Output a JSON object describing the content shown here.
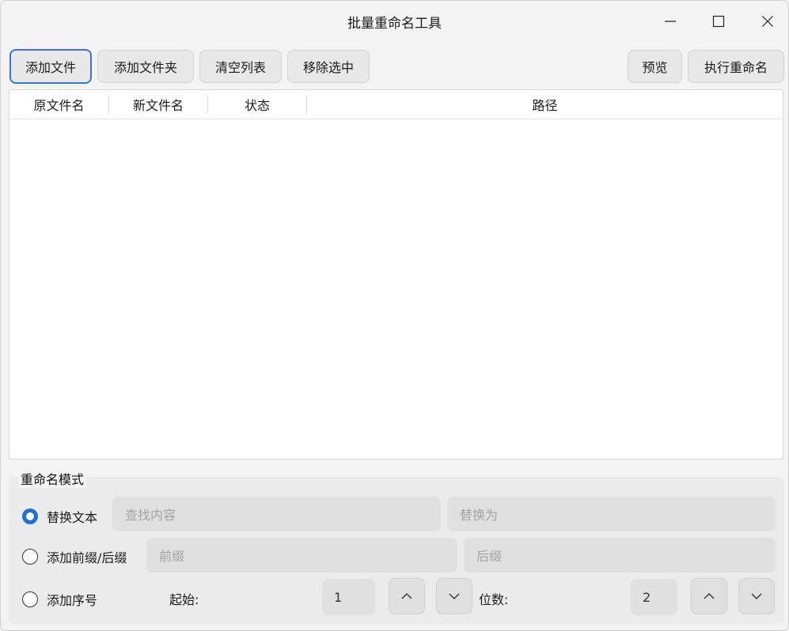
{
  "window": {
    "title": "批量重命名工具"
  },
  "toolbar": {
    "add_file": "添加文件",
    "add_folder": "添加文件夹",
    "clear_list": "清空列表",
    "remove_selected": "移除选中",
    "preview": "预览",
    "execute_rename": "执行重命名"
  },
  "table": {
    "columns": [
      "原文件名",
      "新文件名",
      "状态",
      "路径"
    ],
    "rows": []
  },
  "rename_mode": {
    "title": "重命名模式",
    "selected": "替换文本",
    "replace": {
      "label": "替换文本",
      "find_placeholder": "查找内容",
      "replace_placeholder": "替换为"
    },
    "affix": {
      "label": "添加前缀/后缀",
      "prefix_placeholder": "前缀",
      "suffix_placeholder": "后缀"
    },
    "sequence": {
      "label": "添加序号",
      "start_label": "起始:",
      "start_value": "1",
      "digits_label": "位数:",
      "digits_value": "2"
    }
  },
  "colors": {
    "accent": "#1f6fd8",
    "focus_border": "#3a75d6"
  }
}
